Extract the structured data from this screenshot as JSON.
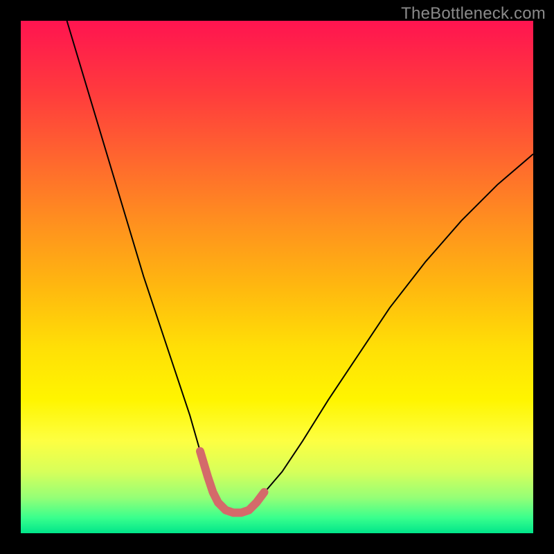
{
  "watermark": {
    "text": "TheBottleneck.com"
  },
  "chart_data": {
    "type": "line",
    "title": "",
    "xlabel": "",
    "ylabel": "",
    "xlim": [
      0,
      100
    ],
    "ylim": [
      0,
      100
    ],
    "grid": false,
    "legend": false,
    "annotations": [],
    "series": [
      {
        "name": "bottleneck-curve",
        "color": "#000000",
        "stroke_width": 2,
        "x": [
          9,
          12,
          15,
          18,
          21,
          24,
          27,
          30,
          33,
          35,
          36.5,
          37.5,
          38.5,
          40,
          41.5,
          43,
          44.5,
          46,
          48,
          51,
          55,
          60,
          66,
          72,
          79,
          86,
          93,
          100
        ],
        "y": [
          100,
          90,
          80,
          70,
          60,
          50,
          41,
          32,
          23,
          16,
          11,
          8,
          6,
          4.5,
          4,
          4,
          4.5,
          6,
          8.5,
          12,
          18,
          26,
          35,
          44,
          53,
          61,
          68,
          74
        ]
      },
      {
        "name": "optimal-zone-overlay",
        "color": "#d46a6a",
        "stroke_width": 12,
        "stroke_linecap": "round",
        "x": [
          35,
          36.5,
          37.5,
          38.5,
          40,
          41.5,
          43,
          44.5,
          46,
          47.5
        ],
        "y": [
          16,
          11,
          8,
          6,
          4.5,
          4,
          4,
          4.5,
          6,
          8
        ]
      }
    ],
    "background_gradient": {
      "direction": "top-to-bottom",
      "stops": [
        {
          "pos": 0.0,
          "color": "#ff1450"
        },
        {
          "pos": 0.5,
          "color": "#ffb80f"
        },
        {
          "pos": 0.78,
          "color": "#fff500"
        },
        {
          "pos": 1.0,
          "color": "#00e58a"
        }
      ]
    }
  }
}
